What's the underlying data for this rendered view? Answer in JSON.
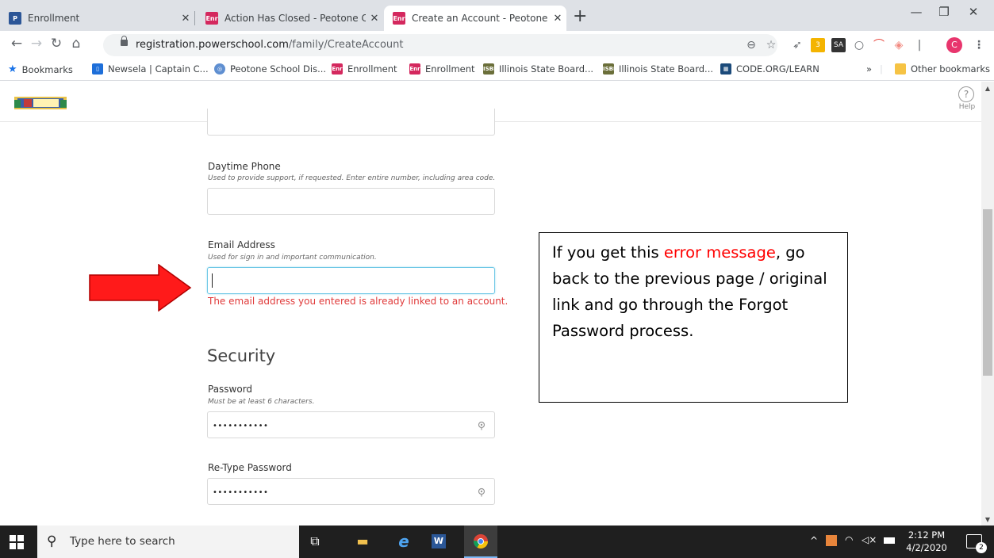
{
  "browser": {
    "tabs": [
      {
        "title": "Enrollment",
        "favicon": "P",
        "favicon_color": "#2c5697",
        "active": false
      },
      {
        "title": "Action Has Closed - Peotone Con",
        "favicon": "Enr",
        "favicon_color": "#d4285e",
        "active": false
      },
      {
        "title": "Create an Account - Peotone Con",
        "favicon": "Enr",
        "favicon_color": "#d4285e",
        "active": true
      }
    ],
    "url_host": "registration.powerschool.com",
    "url_path": "/family/CreateAccount",
    "profile_initial": "C",
    "bookmarks": [
      {
        "label": "Bookmarks",
        "icon": "star-icon"
      },
      {
        "label": "Newsela | Captain C...",
        "icon": "newsela-icon"
      },
      {
        "label": "Peotone School Dis...",
        "icon": "peotone-icon"
      },
      {
        "label": "Enrollment",
        "icon": "enr-icon"
      },
      {
        "label": "Enrollment",
        "icon": "enr-icon"
      },
      {
        "label": "Illinois State Board...",
        "icon": "isbe-icon"
      },
      {
        "label": "Illinois State Board...",
        "icon": "isbe-icon"
      },
      {
        "label": "CODE.ORG/LEARN",
        "icon": "codeorg-icon"
      }
    ],
    "bookmarks_overflow": "»",
    "other_bookmarks": "Other bookmarks"
  },
  "header": {
    "help_label": "Help",
    "help_glyph": "?"
  },
  "form": {
    "daytime_phone": {
      "label": "Daytime Phone",
      "hint": "Used to provide support, if requested. Enter entire number, including area code.",
      "value": ""
    },
    "email": {
      "label": "Email Address",
      "hint": "Used for sign in and important communication.",
      "value": "",
      "error": "The email address you entered is already linked to an account."
    },
    "security_heading": "Security",
    "password": {
      "label": "Password",
      "hint": "Must be at least 6 characters.",
      "masked_value": "•••••••••••"
    },
    "retype_password": {
      "label": "Re-Type Password",
      "masked_value": "•••••••••••"
    }
  },
  "annotation": {
    "before": "If you get this ",
    "highlight": "error message",
    "after": ", go back to the previous page / original link and go through the Forgot Password process.",
    "highlight_color": "#ff0000",
    "arrow_color": "#ff0000"
  },
  "taskbar": {
    "search_placeholder": "Type here to search",
    "time": "2:12 PM",
    "date": "4/2/2020",
    "notification_count": "2"
  }
}
